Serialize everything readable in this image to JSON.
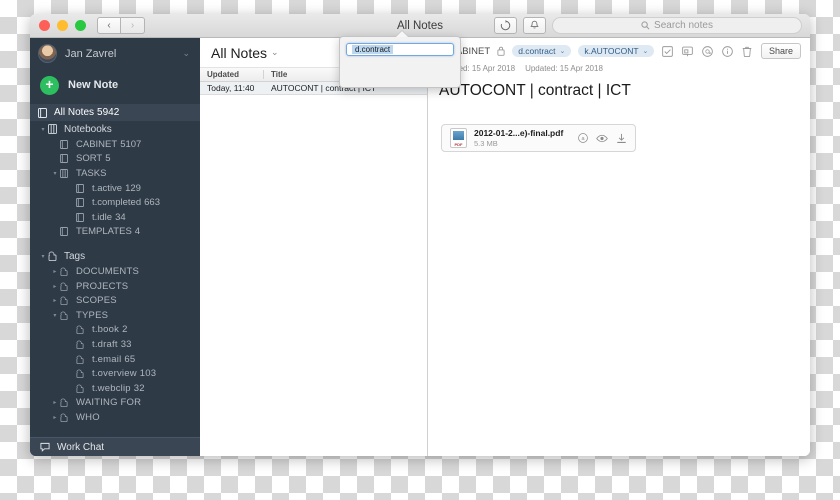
{
  "window": {
    "title": "All Notes",
    "nav_back": "‹",
    "nav_forward": "›",
    "sync_icon": "sync-icon",
    "bell_icon": "bell-icon"
  },
  "search": {
    "placeholder": "Search notes",
    "icon": "search-icon"
  },
  "sidebar": {
    "account": {
      "name": "Jan Zavrel",
      "chevron": "⌄",
      "avatar": "user-avatar"
    },
    "new_note": {
      "label": "New Note",
      "icon": "plus-circle-icon"
    },
    "all_notes": {
      "label": "All Notes",
      "count": "5942",
      "icon": "notebook-icon"
    },
    "notebooks": {
      "label": "Notebooks",
      "icon": "notebooks-icon",
      "items": [
        {
          "label": "CABINET",
          "count": "5107",
          "icon": "notebook-icon",
          "level": 1,
          "expandable": false
        },
        {
          "label": "SORT",
          "count": "5",
          "icon": "notebook-icon",
          "level": 1,
          "expandable": false
        },
        {
          "label": "TASKS",
          "count": "",
          "icon": "stack-icon",
          "level": 1,
          "expandable": true
        },
        {
          "label": "t.active",
          "count": "129",
          "icon": "notebook-icon",
          "level": 2,
          "expandable": false
        },
        {
          "label": "t.completed",
          "count": "663",
          "icon": "notebook-icon",
          "level": 2,
          "expandable": false
        },
        {
          "label": "t.idle",
          "count": "34",
          "icon": "notebook-icon",
          "level": 2,
          "expandable": false
        },
        {
          "label": "TEMPLATES",
          "count": "4",
          "icon": "notebook-icon",
          "level": 1,
          "expandable": false
        }
      ]
    },
    "tags": {
      "label": "Tags",
      "icon": "tag-icon",
      "items": [
        {
          "label": "DOCUMENTS",
          "count": "",
          "icon": "tag-icon",
          "level": 1,
          "expandable": true
        },
        {
          "label": "PROJECTS",
          "count": "",
          "icon": "tag-icon",
          "level": 1,
          "expandable": true
        },
        {
          "label": "SCOPES",
          "count": "",
          "icon": "tag-icon",
          "level": 1,
          "expandable": true
        },
        {
          "label": "TYPES",
          "count": "",
          "icon": "tag-icon",
          "level": 1,
          "expandable": true
        },
        {
          "label": "t.book",
          "count": "2",
          "icon": "tag-icon",
          "level": 2,
          "expandable": false
        },
        {
          "label": "t.draft",
          "count": "33",
          "icon": "tag-icon",
          "level": 2,
          "expandable": false
        },
        {
          "label": "t.email",
          "count": "65",
          "icon": "tag-icon",
          "level": 2,
          "expandable": false
        },
        {
          "label": "t.overview",
          "count": "103",
          "icon": "tag-icon",
          "level": 2,
          "expandable": false
        },
        {
          "label": "t.webclip",
          "count": "32",
          "icon": "tag-icon",
          "level": 2,
          "expandable": false
        },
        {
          "label": "WAITING FOR",
          "count": "",
          "icon": "tag-icon",
          "level": 1,
          "expandable": true
        },
        {
          "label": "WHO",
          "count": "",
          "icon": "tag-icon",
          "level": 1,
          "expandable": true
        }
      ]
    },
    "work_chat": {
      "label": "Work Chat",
      "icon": "chat-icon"
    }
  },
  "note_list": {
    "title": "All Notes",
    "title_chevron": "⌄",
    "tools": [
      {
        "name": "sort-icon",
        "label": "sort"
      },
      {
        "name": "view-layout-icon",
        "label": "view"
      },
      {
        "name": "tag-filter-icon",
        "label": "tag",
        "active": true
      },
      {
        "name": "close-icon",
        "label": "×"
      }
    ],
    "columns": [
      "Updated",
      "Title"
    ],
    "rows": [
      {
        "updated": "Today, 11:40",
        "title": "AUTOCONT | contract | ICT"
      }
    ]
  },
  "tag_popover": {
    "value": "d.contract"
  },
  "note": {
    "notebook": "CABINET",
    "notebook_icon": "notebook-icon",
    "lock_icon": "lock-icon",
    "tags": [
      "d.contract",
      "k.AUTOCONT"
    ],
    "tag_chevron": "⌄",
    "created": "Created: 15 Apr 2018",
    "updated": "Updated: 15 Apr 2018",
    "title": "AUTOCONT | contract | ICT",
    "actions": [
      {
        "name": "checkbox-icon"
      },
      {
        "name": "presentation-icon"
      },
      {
        "name": "at-mention-icon"
      },
      {
        "name": "info-icon"
      },
      {
        "name": "trash-icon"
      }
    ],
    "share_label": "Share",
    "attachment": {
      "filename": "2012-01-2...e)-final.pdf",
      "size": "5.3 MB",
      "type_label": "PDF",
      "actions": [
        {
          "name": "annotate-icon"
        },
        {
          "name": "preview-eye-icon"
        },
        {
          "name": "download-icon"
        }
      ]
    }
  },
  "colors": {
    "sidebar_bg": "#2f3a47",
    "sidebar_selected": "#3a4654",
    "accent_green": "#2dbe60",
    "accent_blue": "#3a8fd4",
    "tag_chip_bg": "#dfe9f3"
  }
}
